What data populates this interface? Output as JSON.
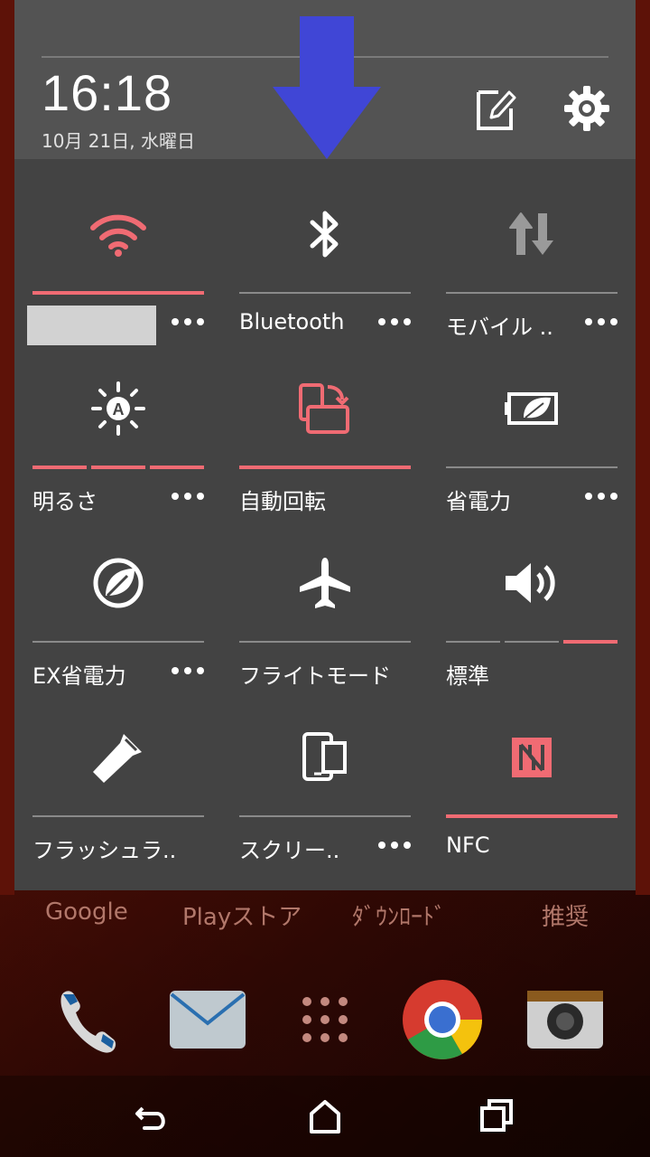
{
  "status": {
    "time": "16:18",
    "date": "10月 21日, 水曜日"
  },
  "header": {
    "edit_icon": "edit-icon",
    "settings_icon": "settings-icon"
  },
  "tiles": [
    {
      "label": "",
      "icon": "wifi-icon",
      "active": true,
      "more": true,
      "ssid_redacted": true
    },
    {
      "label": "Bluetooth",
      "icon": "bluetooth-icon",
      "active": false,
      "more": true
    },
    {
      "label": "モバイル ..",
      "icon": "mobile-data-icon",
      "active": false,
      "more": true
    },
    {
      "label": "明るさ",
      "icon": "auto-brightness-icon",
      "active": true,
      "more": true,
      "level": "3/3"
    },
    {
      "label": "自動回転",
      "icon": "auto-rotate-icon",
      "active": true,
      "more": false
    },
    {
      "label": "省電力",
      "icon": "power-saver-icon",
      "active": false,
      "more": true
    },
    {
      "label": "EX省電力",
      "icon": "extreme-power-saver-icon",
      "active": false,
      "more": true
    },
    {
      "label": "フライトモード",
      "icon": "airplane-icon",
      "active": false,
      "more": false
    },
    {
      "label": "標準",
      "icon": "volume-icon",
      "active": true,
      "more": false,
      "level": "3/3"
    },
    {
      "label": "フラッシュラ..",
      "icon": "flashlight-icon",
      "active": false,
      "more": false
    },
    {
      "label": "スクリー..",
      "icon": "screen-cast-icon",
      "active": false,
      "more": true
    },
    {
      "label": "NFC",
      "icon": "nfc-icon",
      "active": true,
      "more": false
    }
  ],
  "colors": {
    "accent": "#f06b73",
    "shade_bg": "#434343",
    "header_bg": "#535353",
    "arrow": "#4046d6"
  },
  "home": {
    "folders": [
      "Google",
      "Playストア",
      "ﾀﾞｳﾝﾛｰﾄﾞ",
      "推奨"
    ],
    "dock": [
      "phone-icon",
      "mail-icon",
      "app-drawer-icon",
      "chrome-icon",
      "camera-icon"
    ]
  },
  "nav": [
    "back-icon",
    "home-icon",
    "recents-icon"
  ]
}
